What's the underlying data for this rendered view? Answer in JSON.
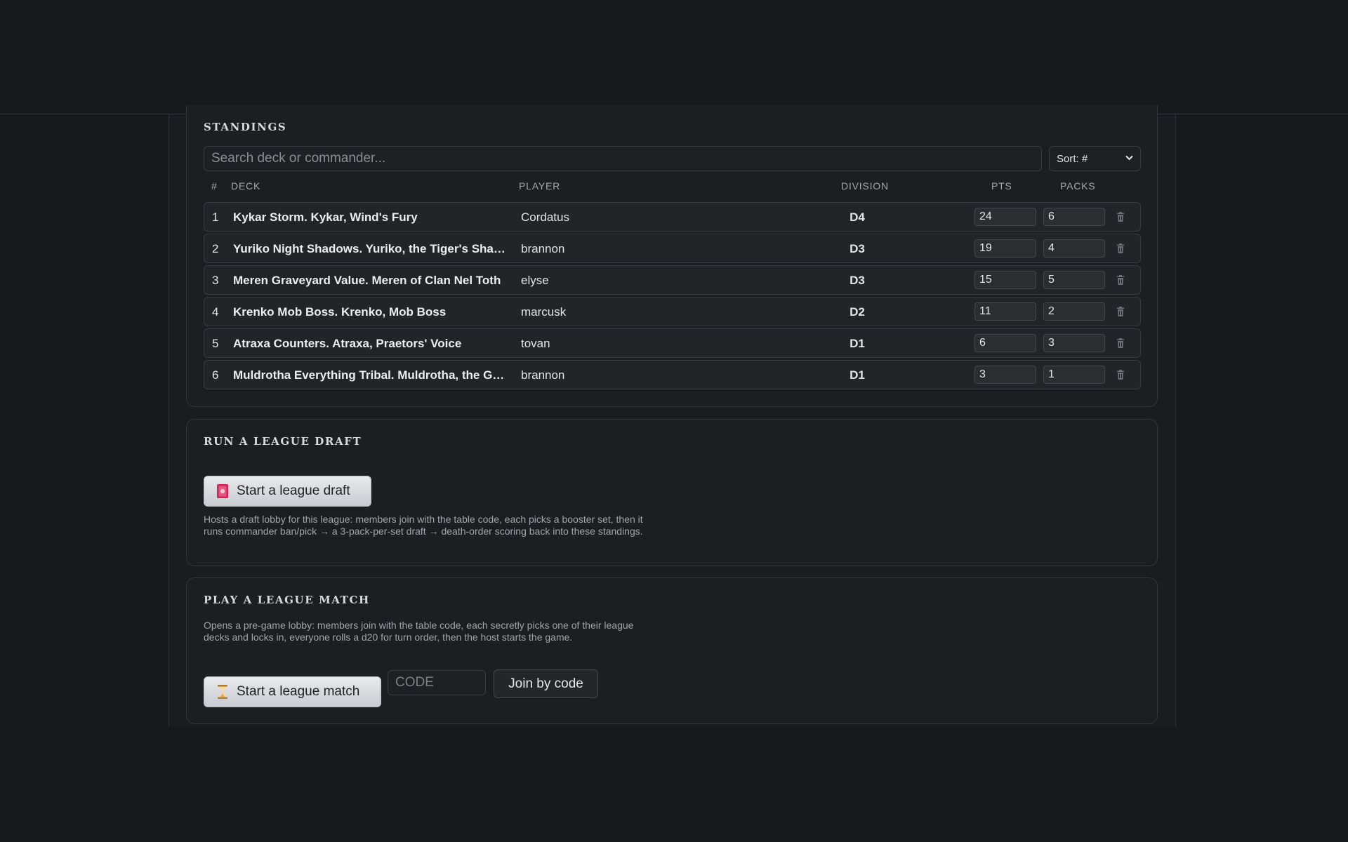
{
  "standings": {
    "title": "STANDINGS",
    "search_placeholder": "Search deck or commander...",
    "sort_label": "Sort: #",
    "headers": {
      "rank": "#",
      "deck": "DECK",
      "player": "PLAYER",
      "division": "DIVISION",
      "pts": "PTS",
      "packs": "PACKS"
    },
    "rows": [
      {
        "rank": "1",
        "deck": "Kykar Storm. Kykar, Wind's Fury",
        "player": "Cordatus",
        "division": "D4",
        "pts": "24",
        "packs": "6"
      },
      {
        "rank": "2",
        "deck": "Yuriko Night Shadows. Yuriko, the Tiger's Shadow",
        "player": "brannon",
        "division": "D3",
        "pts": "19",
        "packs": "4"
      },
      {
        "rank": "3",
        "deck": "Meren Graveyard Value. Meren of Clan Nel Toth",
        "player": "elyse",
        "division": "D3",
        "pts": "15",
        "packs": "5"
      },
      {
        "rank": "4",
        "deck": "Krenko Mob Boss. Krenko, Mob Boss",
        "player": "marcusk",
        "division": "D2",
        "pts": "11",
        "packs": "2"
      },
      {
        "rank": "5",
        "deck": "Atraxa Counters. Atraxa, Praetors' Voice",
        "player": "tovan",
        "division": "D1",
        "pts": "6",
        "packs": "3"
      },
      {
        "rank": "6",
        "deck": "Muldrotha Everything Tribal. Muldrotha, the Gra...",
        "player": "brannon",
        "division": "D1",
        "pts": "3",
        "packs": "1"
      }
    ]
  },
  "draft": {
    "title": "RUN A LEAGUE DRAFT",
    "button_label": "Start a league draft",
    "button_icon": "playing-card-icon",
    "description": "Hosts a draft lobby for this league: members join with the table code, each picks a booster set, then it runs commander ban/pick → a 3-pack-per-set draft → death-order scoring back into these standings."
  },
  "match": {
    "title": "PLAY A LEAGUE MATCH",
    "description": "Opens a pre-game lobby: members join with the table code, each secretly picks one of their league decks and locks in, everyone rolls a d20 for turn order, then the host starts the game.",
    "button_label": "Start a league match",
    "button_icon": "hourglass-icon",
    "code_placeholder": "CODE",
    "join_label": "Join by code"
  }
}
